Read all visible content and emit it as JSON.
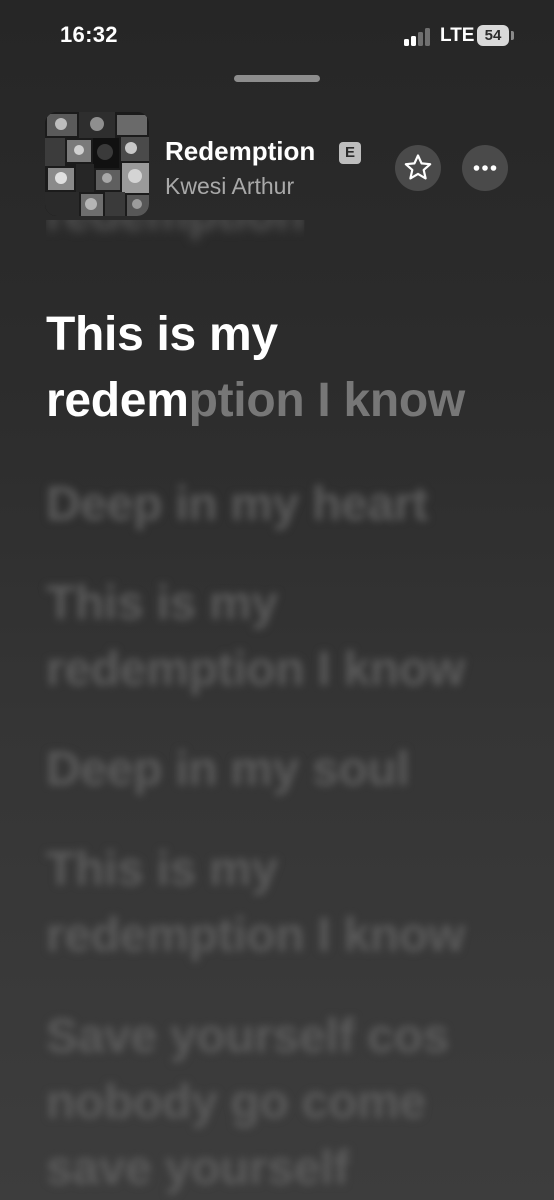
{
  "status_bar": {
    "time": "16:32",
    "network": "LTE",
    "battery": "54"
  },
  "now_playing": {
    "title": "Redemption",
    "explicit_label": "E",
    "artist": "Kwesi Arthur",
    "artwork_icon": "album-artwork",
    "favorite_icon": "star-icon",
    "more_icon": "ellipsis-icon"
  },
  "lyrics": {
    "previous": "redemption",
    "current_line1": "This is my",
    "current_line2_sung": "redem",
    "current_line2_unsung": "ption I know",
    "upcoming": [
      "Deep in my heart",
      "This is my",
      "redemption I know",
      "Deep in my soul",
      "This is my",
      "redemption I know",
      "Save yourself cos",
      "nobody go come",
      "save yourself"
    ]
  },
  "colors": {
    "background_top": "#262626",
    "background_bottom": "#3d3d3d",
    "active_lyric": "#ffffff",
    "inactive_lyric": "#5b5b5b",
    "secondary_text": "#a9a9a9"
  }
}
